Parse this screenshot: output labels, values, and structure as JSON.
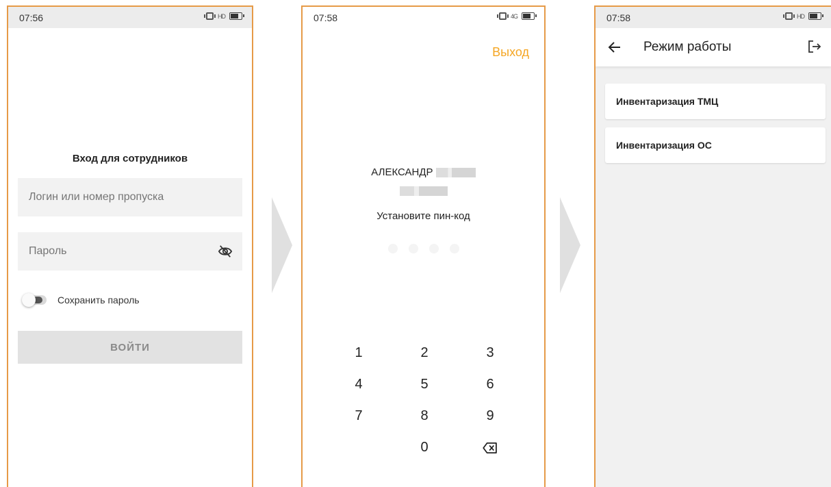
{
  "screen1": {
    "time": "07:56",
    "network": "HD",
    "title": "Вход для сотрудников",
    "login_placeholder": "Логин или номер пропуска",
    "password_placeholder": "Пароль",
    "save_password_label": "Сохранить пароль",
    "login_button": "ВОЙТИ"
  },
  "screen2": {
    "time": "07:58",
    "network": "4G",
    "exit_label": "Выход",
    "user_name": "АЛЕКСАНДР",
    "prompt": "Установите пин-код",
    "keys": [
      "1",
      "2",
      "3",
      "4",
      "5",
      "6",
      "7",
      "8",
      "9",
      "",
      "0",
      "backspace-icon"
    ]
  },
  "screen3": {
    "time": "07:58",
    "network": "HD",
    "title": "Режим работы",
    "items": [
      {
        "label": "Инвентаризация ТМЦ"
      },
      {
        "label": "Инвентаризация ОС"
      }
    ]
  },
  "colors": {
    "accent": "#f5a623",
    "frame": "#e69a47"
  }
}
